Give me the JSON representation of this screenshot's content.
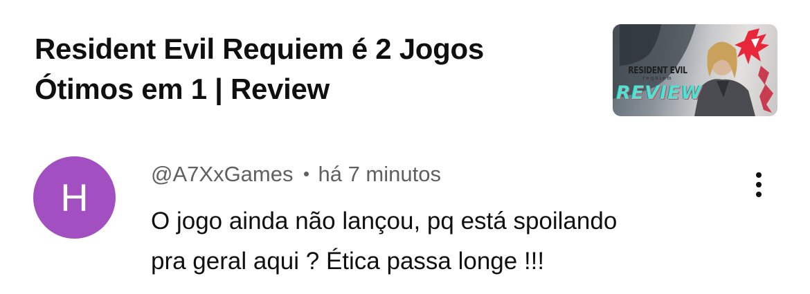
{
  "video": {
    "title_line1": "Resident Evil Requiem é 2 Jogos",
    "title_line2": "Ótimos em 1 | Review",
    "thumbnail": {
      "brand_line1": "RESIDENT EVIL",
      "brand_line2": "requiem",
      "badge": "REVIEW",
      "accent_color": "#53e0d0",
      "logo_color": "#e8283a"
    }
  },
  "comment": {
    "avatar_letter": "H",
    "avatar_color": "#a24fc1",
    "author": "@A7XxGames",
    "time": "há 7 minutos",
    "text_line1": "O jogo ainda não lançou, pq está spoilando",
    "text_line2": "pra geral aqui ? Ética passa longe !!!",
    "more_icon": "more-vertical-icon"
  }
}
